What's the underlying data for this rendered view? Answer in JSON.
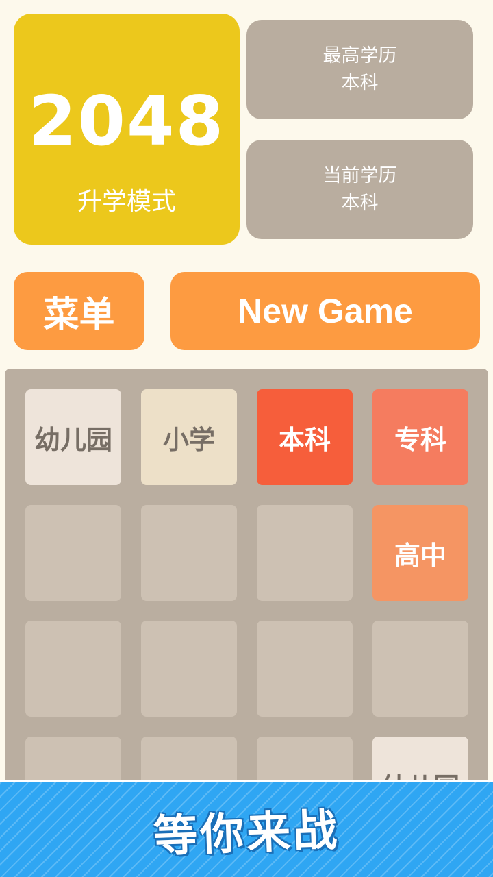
{
  "logo": {
    "number": "2048",
    "mode": "升学模式"
  },
  "stats": {
    "best": {
      "label": "最高学历",
      "value": "本科"
    },
    "current": {
      "label": "当前学历",
      "value": "本科"
    }
  },
  "buttons": {
    "menu": "菜单",
    "new_game": "New Game"
  },
  "board": {
    "rows": [
      [
        "幼儿园",
        "小学",
        "本科",
        "专科"
      ],
      [
        "",
        "",
        "",
        "高中"
      ],
      [
        "",
        "",
        "",
        ""
      ],
      [
        "",
        "",
        "",
        "幼儿园"
      ]
    ]
  },
  "banner": {
    "text": "等你来战"
  },
  "colors": {
    "background": "#fdf9ec",
    "logo": "#ecc81c",
    "stat_box": "#b9ad9f",
    "button": "#fd9b41",
    "board": "#baaea0",
    "empty_cell": "#cdc1b3",
    "banner": "#2fa6f3"
  }
}
